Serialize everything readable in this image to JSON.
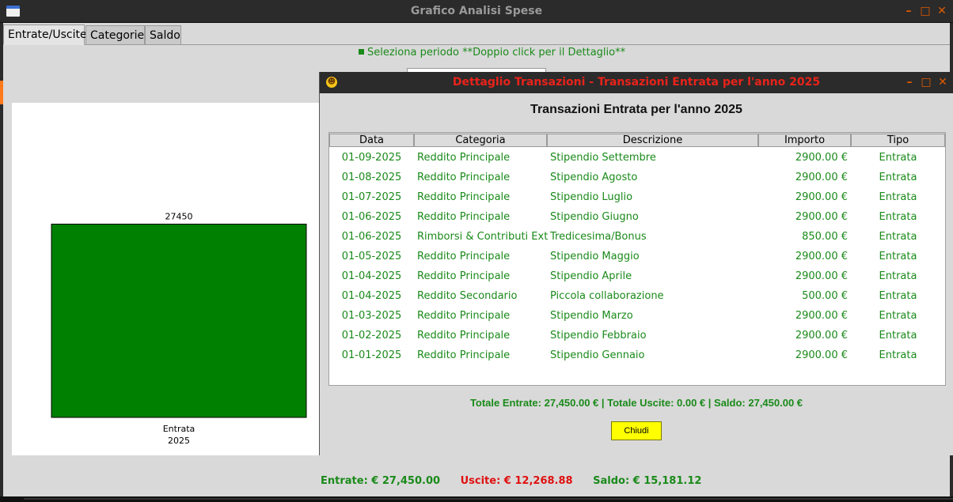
{
  "main_window": {
    "title": "Grafico Analisi Spese",
    "controls": {
      "minimize": "–",
      "maximize": "□",
      "close": "✕"
    }
  },
  "tabs": [
    {
      "label": "Entrate/Uscite",
      "active": true
    },
    {
      "label": "Categorie",
      "active": false
    },
    {
      "label": "Saldo",
      "active": false
    }
  ],
  "period_hint": "Seleziona periodo **Doppio click per il Dettaglio**",
  "chart_data": {
    "type": "bar",
    "categories": [
      "Entrata\n2025"
    ],
    "category_lines": [
      "Entrata",
      "2025"
    ],
    "values": [
      27450
    ],
    "value_labels": [
      "27450"
    ],
    "bar_color": "#008000",
    "ylim": [
      0,
      43000
    ]
  },
  "summary": {
    "entrate": "Entrate: € 27,450.00",
    "uscite": "Uscite: € 12,268.88",
    "saldo": "Saldo: € 15,181.12"
  },
  "colors": {
    "income_green": "#1a8a1a",
    "expense_red": "#e01010",
    "dialog_title_red": "#e8231a",
    "close_button_yellow": "#ffff00",
    "window_control_orange": "#e05a00"
  },
  "dialog": {
    "title": "Dettaglio Transazioni - Transazioni Entrata per l'anno 2025",
    "heading": "Transazioni Entrata per l'anno 2025",
    "icon": "emoji-face-icon",
    "controls": {
      "minimize": "–",
      "maximize": "□",
      "close": "✕"
    },
    "columns": [
      "Data",
      "Categoria",
      "Descrizione",
      "Importo",
      "Tipo"
    ],
    "rows": [
      [
        "01-09-2025",
        "Reddito Principale",
        "Stipendio Settembre",
        "2900.00 €",
        "Entrata"
      ],
      [
        "01-08-2025",
        "Reddito Principale",
        "Stipendio Agosto",
        "2900.00 €",
        "Entrata"
      ],
      [
        "01-07-2025",
        "Reddito Principale",
        "Stipendio Luglio",
        "2900.00 €",
        "Entrata"
      ],
      [
        "01-06-2025",
        "Reddito Principale",
        "Stipendio Giugno",
        "2900.00 €",
        "Entrata"
      ],
      [
        "01-06-2025",
        "Rimborsi & Contributi Ext",
        "Tredicesima/Bonus",
        "850.00 €",
        "Entrata"
      ],
      [
        "01-05-2025",
        "Reddito Principale",
        "Stipendio Maggio",
        "2900.00 €",
        "Entrata"
      ],
      [
        "01-04-2025",
        "Reddito Principale",
        "Stipendio Aprile",
        "2900.00 €",
        "Entrata"
      ],
      [
        "01-04-2025",
        "Reddito Secondario",
        "Piccola collaborazione",
        "500.00 €",
        "Entrata"
      ],
      [
        "01-03-2025",
        "Reddito Principale",
        "Stipendio Marzo",
        "2900.00 €",
        "Entrata"
      ],
      [
        "01-02-2025",
        "Reddito Principale",
        "Stipendio Febbraio",
        "2900.00 €",
        "Entrata"
      ],
      [
        "01-01-2025",
        "Reddito Principale",
        "Stipendio Gennaio",
        "2900.00 €",
        "Entrata"
      ]
    ],
    "totals": "Totale Entrate: 27,450.00 € | Totale Uscite: 0.00 € | Saldo: 27,450.00 €",
    "close_label": "Chiudi"
  }
}
